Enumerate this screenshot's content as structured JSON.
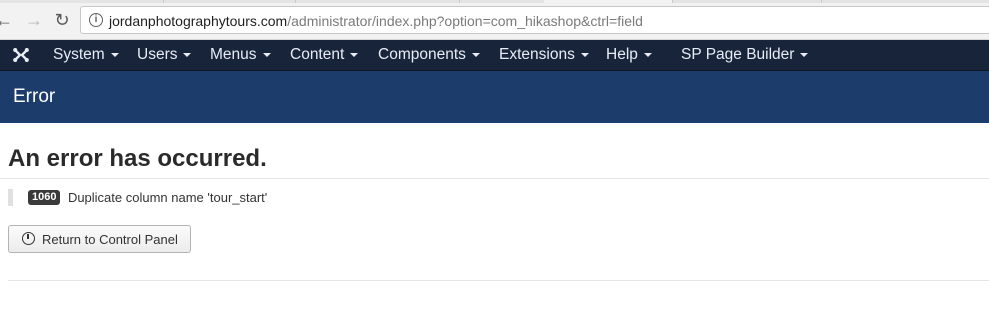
{
  "browser": {
    "url_domain": "jordanphotographytours.com",
    "url_path": "/administrator/index.php?option=com_hikashop&ctrl=field",
    "back_icon": "back-arrow-icon",
    "forward_icon": "forward-arrow-icon",
    "reload_icon": "reload-icon",
    "info_icon": "info-icon"
  },
  "admin_nav": {
    "logo_icon": "joomla-logo-icon",
    "items": [
      {
        "label": "System"
      },
      {
        "label": "Users"
      },
      {
        "label": "Menus"
      },
      {
        "label": "Content"
      },
      {
        "label": "Components"
      },
      {
        "label": "Extensions"
      },
      {
        "label": "Help"
      },
      {
        "label": "SP Page Builder"
      }
    ]
  },
  "header": {
    "title": "Error"
  },
  "main": {
    "heading": "An error has occurred.",
    "error_code": "1060",
    "error_message": "Duplicate column name 'tour_start'",
    "return_button_label": "Return to Control Panel",
    "return_button_icon": "dashboard-icon"
  },
  "colors": {
    "nav_bg": "#17243a",
    "header_bg": "#1c3d6b",
    "badge_bg": "#3a3a3a"
  }
}
